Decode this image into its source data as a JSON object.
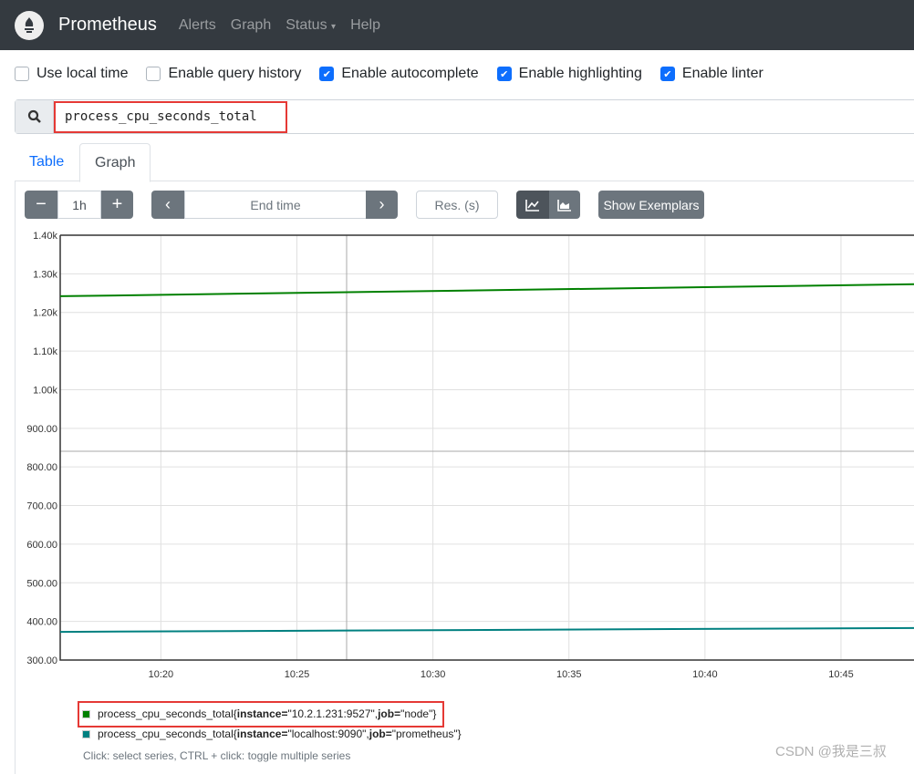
{
  "nav": {
    "brand": "Prometheus",
    "items": [
      "Alerts",
      "Graph",
      "Status",
      "Help"
    ]
  },
  "options": [
    {
      "label": "Use local time",
      "checked": false
    },
    {
      "label": "Enable query history",
      "checked": false
    },
    {
      "label": "Enable autocomplete",
      "checked": true
    },
    {
      "label": "Enable highlighting",
      "checked": true
    },
    {
      "label": "Enable linter",
      "checked": true
    }
  ],
  "query": "process_cpu_seconds_total",
  "tabs": {
    "table": "Table",
    "graph": "Graph"
  },
  "controls": {
    "range": "1h",
    "end_time_placeholder": "End time",
    "resolution_placeholder": "Res. (s)",
    "exemplars": "Show Exemplars"
  },
  "chart_data": {
    "type": "line",
    "y_ticks": [
      "1.40k",
      "1.30k",
      "1.20k",
      "1.10k",
      "1.00k",
      "900.00",
      "800.00",
      "700.00",
      "600.00",
      "500.00",
      "400.00",
      "300.00"
    ],
    "ylim": [
      300,
      1400
    ],
    "x_ticks": [
      "10:20",
      "10:25",
      "10:30",
      "10:35",
      "10:40",
      "10:45"
    ],
    "xlim": [
      "10:16:18",
      "10:47:41"
    ],
    "grid": true,
    "series": [
      {
        "name": "process_cpu_seconds_total{instance=\"10.2.1.231:9527\", job=\"node\"}",
        "color": "#008000",
        "x": [
          "10:16:18",
          "10:47:41"
        ],
        "y": [
          1242,
          1273
        ]
      },
      {
        "name": "process_cpu_seconds_total{instance=\"localhost:9090\", job=\"prometheus\"}",
        "color": "#008080",
        "x": [
          "10:16:18",
          "10:47:41"
        ],
        "y": [
          373,
          383
        ]
      }
    ]
  },
  "legend": {
    "s1": {
      "metric": "process_cpu_seconds_total{",
      "k1": "instance=",
      "v1": "\"10.2.1.231:9527\", ",
      "k2": "job=",
      "v2": "\"node\"}"
    },
    "s2": {
      "metric": "process_cpu_seconds_total{",
      "k1": "instance=",
      "v1": "\"localhost:9090\", ",
      "k2": "job=",
      "v2": "\"prometheus\"}"
    },
    "hint": "Click: select series, CTRL + click: toggle multiple series"
  },
  "watermark": "CSDN @我是三叔"
}
